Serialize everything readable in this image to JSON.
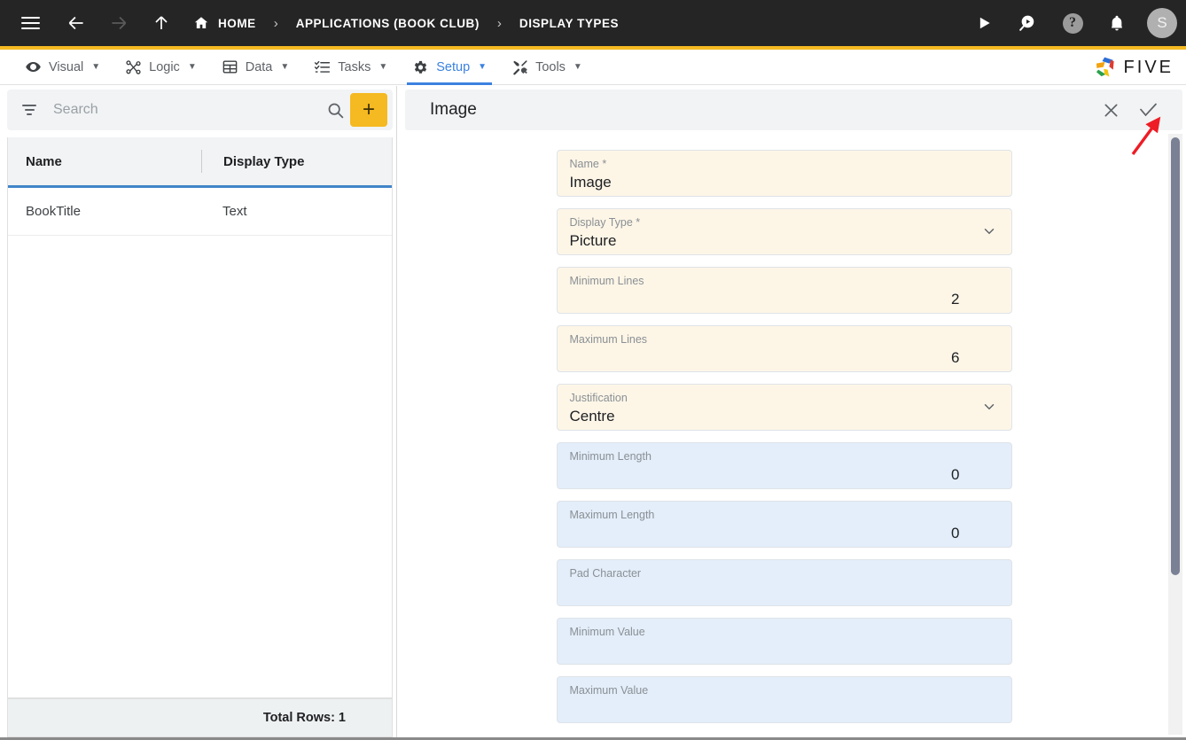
{
  "topbar": {
    "icons": {
      "menu": "hamburger-icon",
      "back": "back-arrow-icon",
      "forward": "forward-arrow-icon",
      "up": "up-arrow-icon",
      "home": "home-icon",
      "run": "play-icon",
      "search_run": "search-play-icon",
      "help": "help-icon",
      "notifications": "bell-icon"
    },
    "breadcrumbs": [
      {
        "label": "HOME"
      },
      {
        "label": "APPLICATIONS (BOOK CLUB)"
      },
      {
        "label": "DISPLAY TYPES"
      }
    ],
    "separator": "›",
    "avatar_initial": "S"
  },
  "menubar": {
    "items": [
      {
        "label": "Visual",
        "icon": "eye-icon",
        "active": false
      },
      {
        "label": "Logic",
        "icon": "node-graph-icon",
        "active": false
      },
      {
        "label": "Data",
        "icon": "table-icon",
        "active": false
      },
      {
        "label": "Tasks",
        "icon": "checklist-icon",
        "active": false
      },
      {
        "label": "Setup",
        "icon": "gear-icon",
        "active": true
      },
      {
        "label": "Tools",
        "icon": "wrench-screwdriver-icon",
        "active": false
      }
    ],
    "caret": "▼",
    "brand": "FIVE"
  },
  "left_panel": {
    "search": {
      "placeholder": "Search",
      "value": ""
    },
    "filter_icon": "filter-icon",
    "search_icon": "search-icon",
    "add_label": "+",
    "grid": {
      "columns": [
        "Name",
        "Display Type"
      ],
      "rows": [
        {
          "name": "BookTitle",
          "display_type": "Text"
        }
      ]
    },
    "footer": "Total Rows: 1"
  },
  "form": {
    "title": "Image",
    "close_icon": "close-icon",
    "save_icon": "check-icon",
    "chevron_icon": "chevron-down-icon",
    "fields": [
      {
        "label": "Name *",
        "value": "Image",
        "style": "cream",
        "align": "left",
        "type": "text"
      },
      {
        "label": "Display Type *",
        "value": "Picture",
        "style": "cream",
        "align": "left",
        "type": "select"
      },
      {
        "label": "Minimum Lines",
        "value": "2",
        "style": "cream",
        "align": "right",
        "type": "number"
      },
      {
        "label": "Maximum Lines",
        "value": "6",
        "style": "cream",
        "align": "right",
        "type": "number"
      },
      {
        "label": "Justification",
        "value": "Centre",
        "style": "cream",
        "align": "left",
        "type": "select"
      },
      {
        "label": "Minimum Length",
        "value": "0",
        "style": "blue",
        "align": "right",
        "type": "number"
      },
      {
        "label": "Maximum Length",
        "value": "0",
        "style": "blue",
        "align": "right",
        "type": "number"
      },
      {
        "label": "Pad Character",
        "value": "",
        "style": "blue",
        "align": "left",
        "type": "text"
      },
      {
        "label": "Minimum Value",
        "value": "",
        "style": "blue",
        "align": "left",
        "type": "text"
      },
      {
        "label": "Maximum Value",
        "value": "",
        "style": "blue",
        "align": "left",
        "type": "text"
      }
    ]
  },
  "annotation": {
    "type": "red-arrow",
    "color": "#EE1C25",
    "points_to": "save-check-button"
  },
  "colors": {
    "topbar_bg": "#252525",
    "accent_yellow": "#F5B921",
    "active_blue": "#3B82E0",
    "field_cream": "#FDF6E7",
    "field_blue": "#E3EEFA",
    "grid_header_underline": "#4285C8"
  }
}
